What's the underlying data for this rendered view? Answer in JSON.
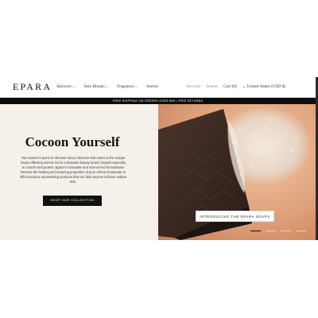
{
  "brand": {
    "logo": "EPARA"
  },
  "nav": {
    "items": [
      {
        "label": "Skincare",
        "has_dropdown": true
      },
      {
        "label": "Skin Rituals",
        "has_dropdown": true
      },
      {
        "label": "Fragrance",
        "has_dropdown": true
      },
      {
        "label": "Stories",
        "has_dropdown": false
      }
    ]
  },
  "utility": {
    "account": "Account",
    "search": "Search",
    "cart": "Cart (0)",
    "region": "United States (USD $)"
  },
  "promo": {
    "text": "FREE SHIPPING ON ORDERS OVER $99 | FREE RETURNS"
  },
  "hero": {
    "title": "Cocoon Yourself",
    "copy": "One woman's quest to discover luxury skincare that caters to the unique issues affecting women led to a bespoke beauty brand created especially to nourish and protect. Epara's innovative and science-led formulations harness the healing and nurturing properties of pure African botanicals to offer luxurious rejuvenating products that can help anyone achieve radiant skin.",
    "cta": "SHOP OUR COLLECTION",
    "image_cta": "INTRODUCING THE EPARA SOAPS"
  },
  "carousel": {
    "slide_count": 4,
    "active_index": 0
  },
  "colors": {
    "hero_bg": "#f5f0ea",
    "image_bg": "#d99a73",
    "promo_bg": "#0d0d0d",
    "button_bg": "#111111"
  },
  "icons": {
    "dropdown": "chevron-down-icon",
    "region": "chevron-down-icon"
  }
}
